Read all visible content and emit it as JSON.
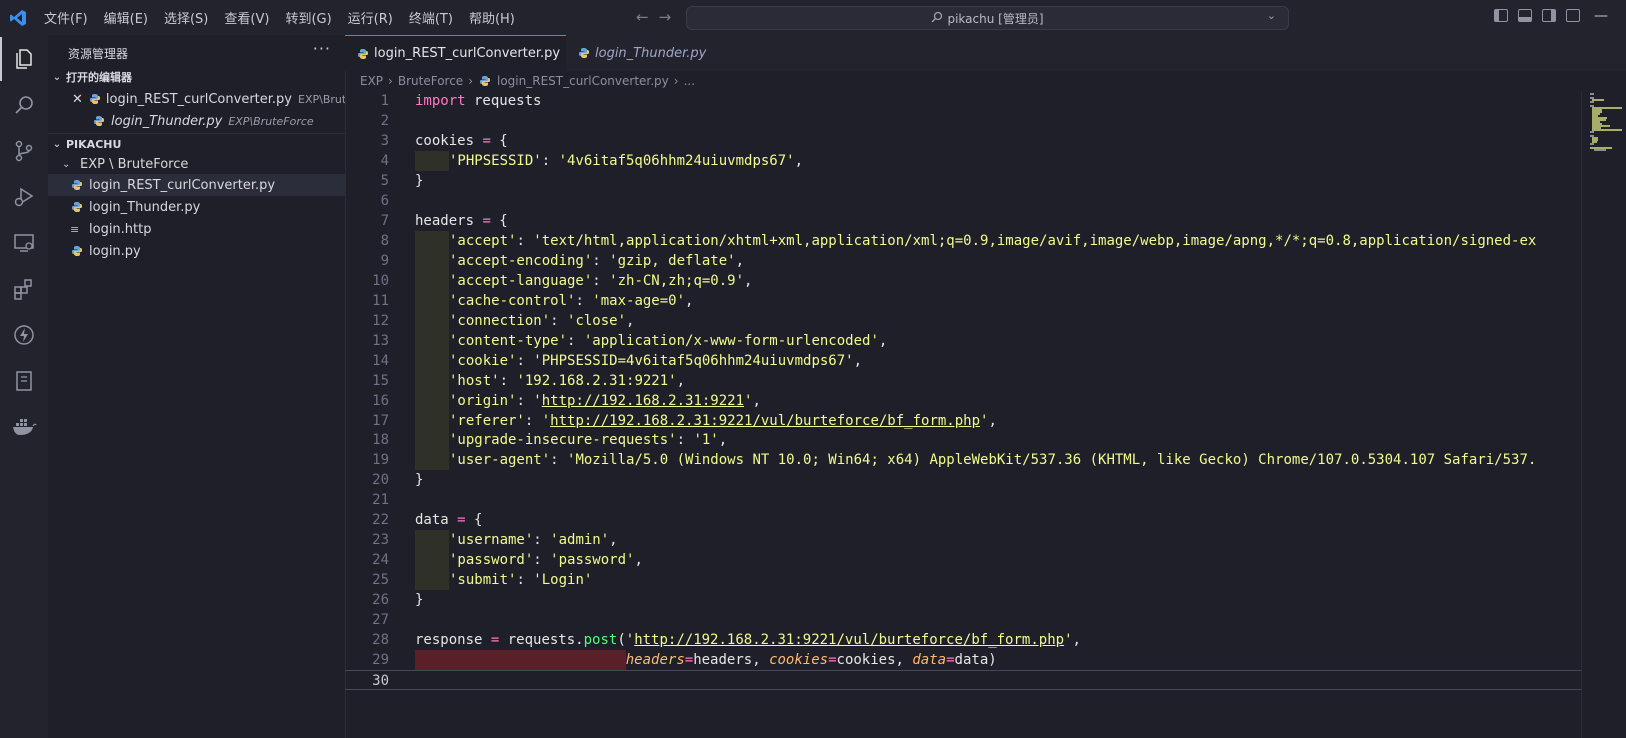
{
  "menu": [
    "文件(F)",
    "编辑(E)",
    "选择(S)",
    "查看(V)",
    "转到(G)",
    "运行(R)",
    "终端(T)",
    "帮助(H)"
  ],
  "command_center": "pikachu [管理员]",
  "sidebar": {
    "title": "资源管理器",
    "open_editors_header": "打开的编辑器",
    "open_editors": [
      {
        "name": "login_REST_curlConverter.py",
        "desc": "EXP\\Brute..."
      },
      {
        "name": "login_Thunder.py",
        "desc": "EXP\\BruteForce"
      }
    ],
    "workspace_header": "PIKACHU",
    "folder": "EXP \\ BruteForce",
    "files": [
      "login_REST_curlConverter.py",
      "login_Thunder.py",
      "login.http",
      "login.py"
    ]
  },
  "tabs": [
    {
      "label": "login_REST_curlConverter.py",
      "active": true
    },
    {
      "label": "login_Thunder.py",
      "active": false
    }
  ],
  "breadcrumb": [
    "EXP",
    "BruteForce",
    "login_REST_curlConverter.py",
    "..."
  ],
  "code_lines": [
    "import requests",
    "",
    "cookies = {",
    "    'PHPSESSID': '4v6itaf5q06hhm24uiuvmdps67',",
    "}",
    "",
    "headers = {",
    "    'accept': 'text/html,application/xhtml+xml,application/xml;q=0.9,image/avif,image/webp,image/apng,*/*;q=0.8,application/signed-ex",
    "    'accept-encoding': 'gzip, deflate',",
    "    'accept-language': 'zh-CN,zh;q=0.9',",
    "    'cache-control': 'max-age=0',",
    "    'connection': 'close',",
    "    'content-type': 'application/x-www-form-urlencoded',",
    "    'cookie': 'PHPSESSID=4v6itaf5q06hhm24uiuvmdps67',",
    "    'host': '192.168.2.31:9221',",
    "    'origin': 'http://192.168.2.31:9221',",
    "    'referer': 'http://192.168.2.31:9221/vul/burteforce/bf_form.php',",
    "    'upgrade-insecure-requests': '1',",
    "    'user-agent': 'Mozilla/5.0 (Windows NT 10.0; Win64; x64) AppleWebKit/537.36 (KHTML, like Gecko) Chrome/107.0.5304.107 Safari/537.",
    "}",
    "",
    "data = {",
    "    'username': 'admin',",
    "    'password': 'password',",
    "    'submit': 'Login'",
    "}",
    "",
    "response = requests.post('http://192.168.2.31:9221/vul/burteforce/bf_form.php',",
    "                         headers=headers, cookies=cookies, data=data)",
    ""
  ],
  "colors": {
    "keyword": "#ff79c6",
    "string": "#f1fa8c",
    "function": "#50fa7b",
    "parameter": "#ffb86c",
    "accent": "#3b8eea"
  }
}
